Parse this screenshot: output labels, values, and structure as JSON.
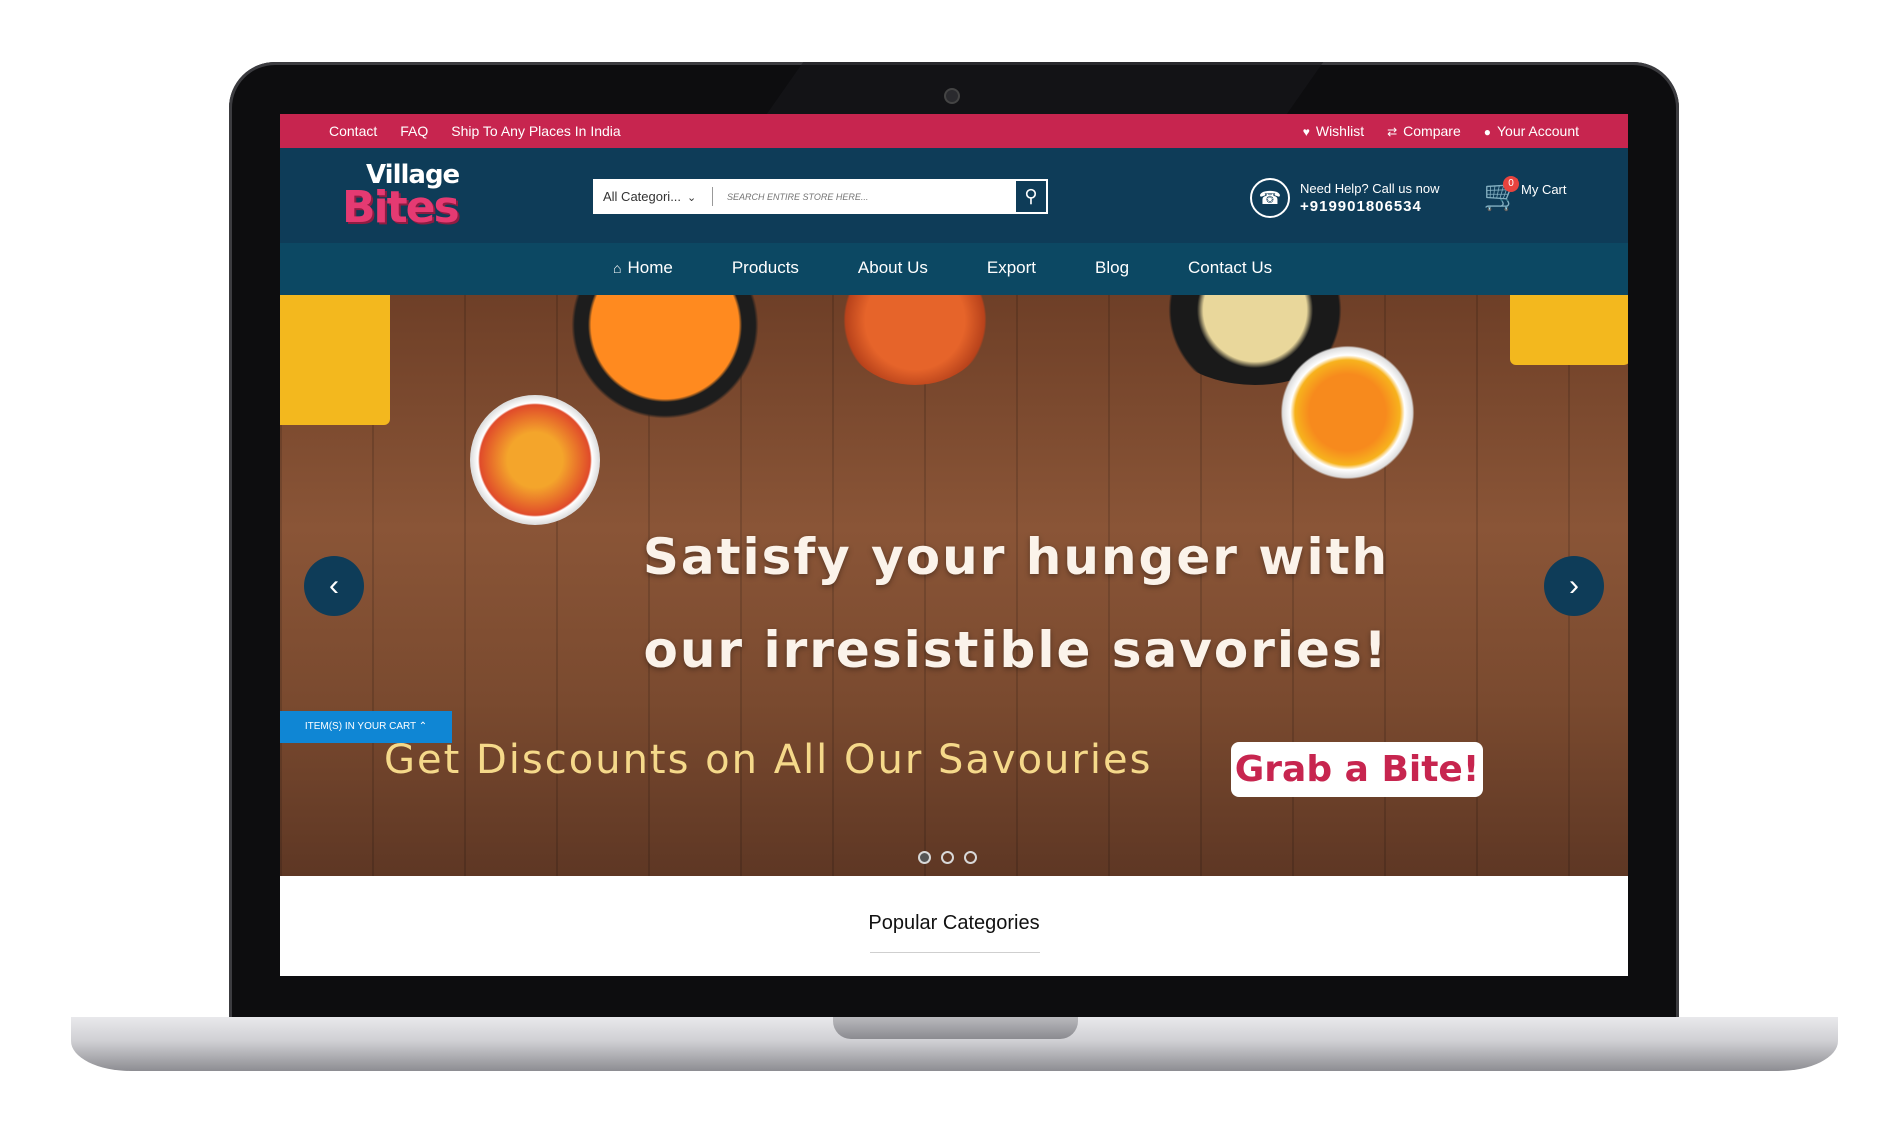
{
  "topbar": {
    "links": [
      "Contact",
      "FAQ",
      "Ship To Any Places In India"
    ],
    "wishlist": "Wishlist",
    "compare": "Compare",
    "account": "Your Account"
  },
  "header": {
    "logo_top": "Village",
    "logo_bottom": "Bites",
    "category": "All Categori...",
    "search_placeholder": "SEARCH ENTIRE STORE HERE...",
    "help_label": "Need Help? Call us now",
    "phone": "+919901806534",
    "cart_count": "0",
    "cart_label": "My Cart"
  },
  "nav": {
    "items": [
      "Home",
      "Products",
      "About Us",
      "Export",
      "Blog",
      "Contact Us"
    ]
  },
  "hero": {
    "line1": "Satisfy your hunger with",
    "line2": "our irresistible savories!",
    "discount": "Get Discounts on All Our Savouries",
    "cta": "Grab a Bite!",
    "cart_tab": "ITEM(S) IN YOUR CART"
  },
  "popular": {
    "title": "Popular Categories"
  },
  "colors": {
    "accent": "#c7254f",
    "header": "#0e3c58",
    "nav": "#0c4863",
    "cart_tab": "#0f86d4"
  }
}
